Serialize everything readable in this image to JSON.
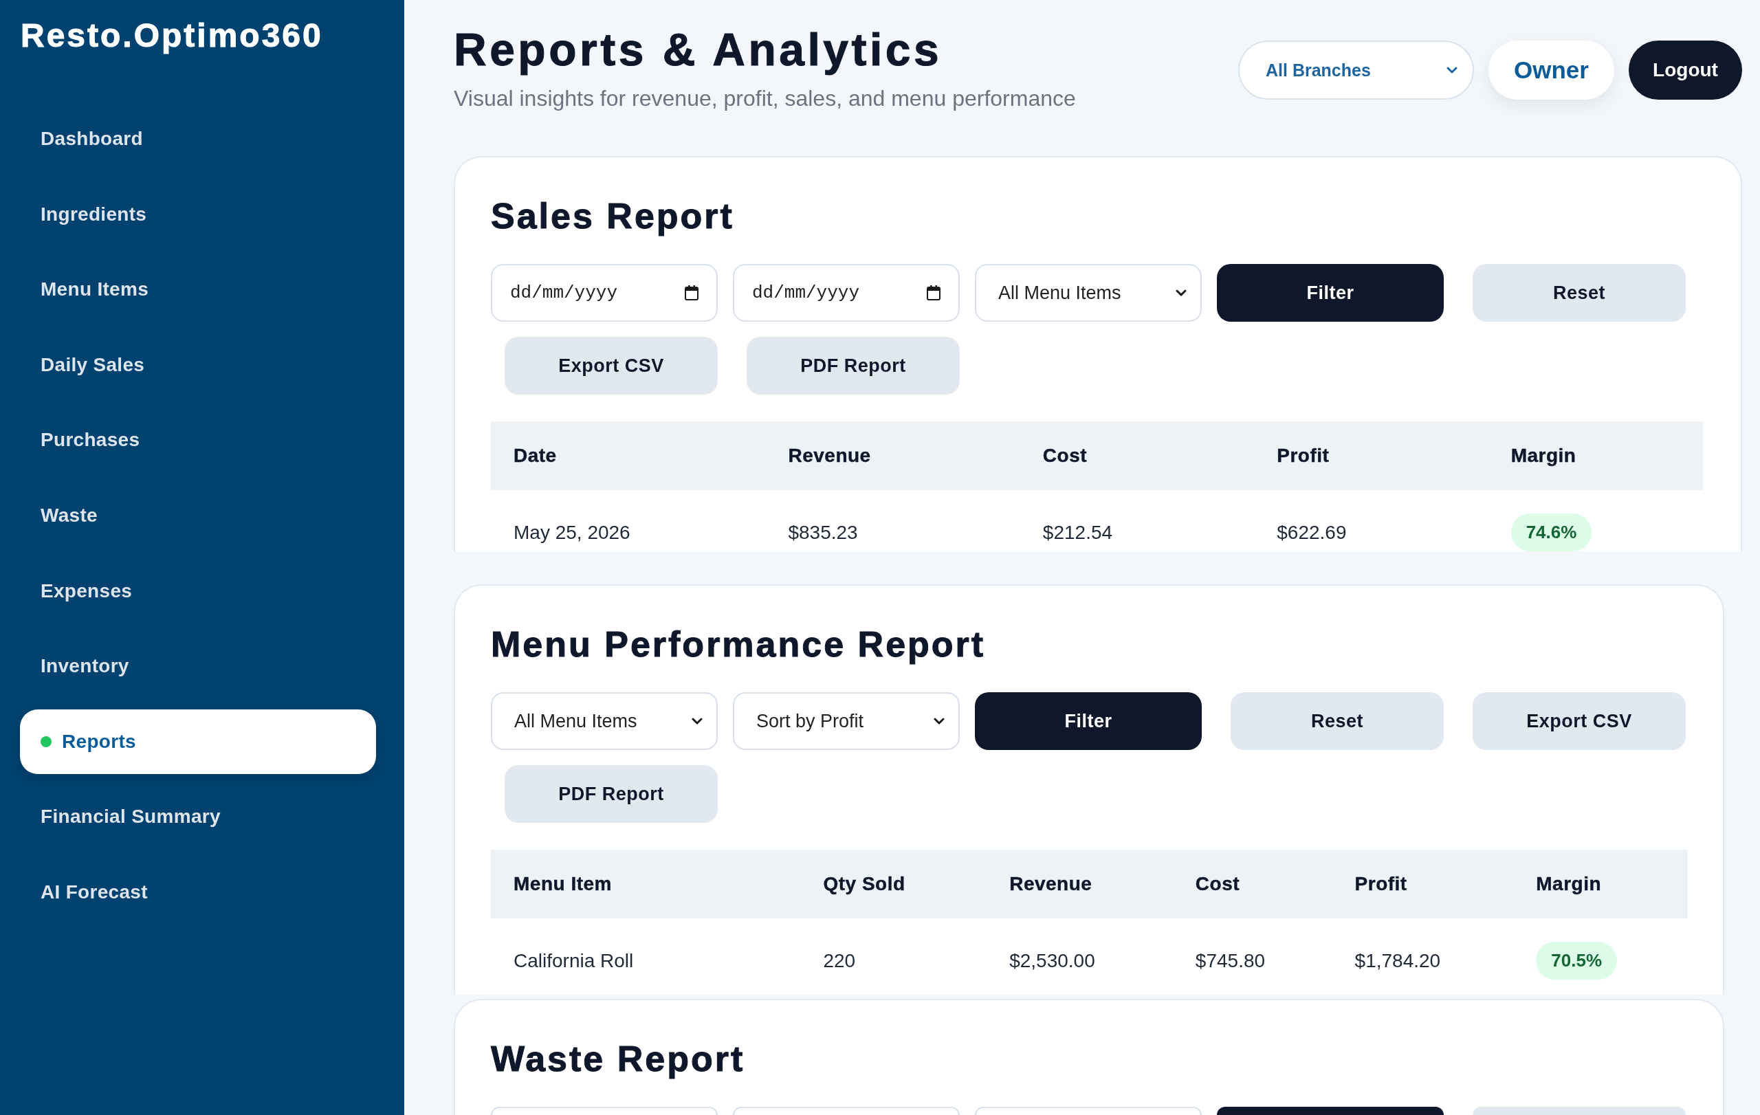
{
  "sidebar": {
    "logo": "Resto.Optimo360",
    "items": [
      {
        "label": "Dashboard",
        "selected": false
      },
      {
        "label": "Ingredients",
        "selected": false
      },
      {
        "label": "Menu Items",
        "selected": false
      },
      {
        "label": "Daily Sales",
        "selected": false
      },
      {
        "label": "Purchases",
        "selected": false
      },
      {
        "label": "Waste",
        "selected": false
      },
      {
        "label": "Expenses",
        "selected": false
      },
      {
        "label": "Inventory",
        "selected": false
      },
      {
        "label": "Reports",
        "selected": true
      },
      {
        "label": "Financial Summary",
        "selected": false
      },
      {
        "label": "AI Forecast",
        "selected": false
      }
    ]
  },
  "page_header": {
    "title": "Reports & Analytics",
    "subtitle": "Visual insights for revenue, profit, sales, and menu performance",
    "branch_dropdown": {
      "value": "All Branches"
    },
    "role_button": "Owner",
    "logout_button": "Logout"
  },
  "sections": [
    {
      "title": "Sales Report",
      "controls": [
        {
          "kind": "date",
          "placeholder": "dd/mm/yyyy"
        },
        {
          "kind": "date",
          "placeholder": "dd/mm/yyyy"
        },
        {
          "kind": "select",
          "value": "All Menu Items"
        },
        {
          "kind": "primary",
          "label": "Filter"
        },
        {
          "kind": "secondary",
          "label": "Reset"
        },
        {
          "kind": "secondary",
          "label": "Export CSV"
        },
        {
          "kind": "secondary",
          "label": "PDF Report"
        }
      ],
      "table": {
        "columns": [
          {
            "label": "Date",
            "kind": "text"
          },
          {
            "label": "Revenue",
            "kind": "text"
          },
          {
            "label": "Cost",
            "kind": "text"
          },
          {
            "label": "Profit",
            "kind": "text"
          },
          {
            "label": "Margin",
            "kind": "badge"
          }
        ],
        "rows": [
          [
            "May 25, 2026",
            "$835.23",
            "$212.54",
            "$622.69",
            "74.6%"
          ]
        ]
      }
    },
    {
      "title": "Menu Performance Report",
      "controls": [
        {
          "kind": "select",
          "value": "All Menu Items"
        },
        {
          "kind": "select",
          "value": "Sort by Profit"
        },
        {
          "kind": "primary",
          "label": "Filter"
        },
        {
          "kind": "secondary",
          "label": "Reset"
        },
        {
          "kind": "secondary",
          "label": "Export CSV"
        },
        {
          "kind": "secondary",
          "label": "PDF Report"
        }
      ],
      "table": {
        "columns": [
          {
            "label": "Menu Item",
            "kind": "text"
          },
          {
            "label": "Qty Sold",
            "kind": "text"
          },
          {
            "label": "Revenue",
            "kind": "text"
          },
          {
            "label": "Cost",
            "kind": "text"
          },
          {
            "label": "Profit",
            "kind": "text"
          },
          {
            "label": "Margin",
            "kind": "badge"
          }
        ],
        "rows": [
          [
            "California Roll",
            "220",
            "$2,530.00",
            "$745.80",
            "$1,784.20",
            "70.5%"
          ]
        ]
      }
    },
    {
      "title": "Waste Report",
      "controls": [
        {
          "kind": "field"
        },
        {
          "kind": "field"
        },
        {
          "kind": "field"
        },
        {
          "kind": "primary"
        },
        {
          "kind": "secondary"
        }
      ]
    }
  ]
}
